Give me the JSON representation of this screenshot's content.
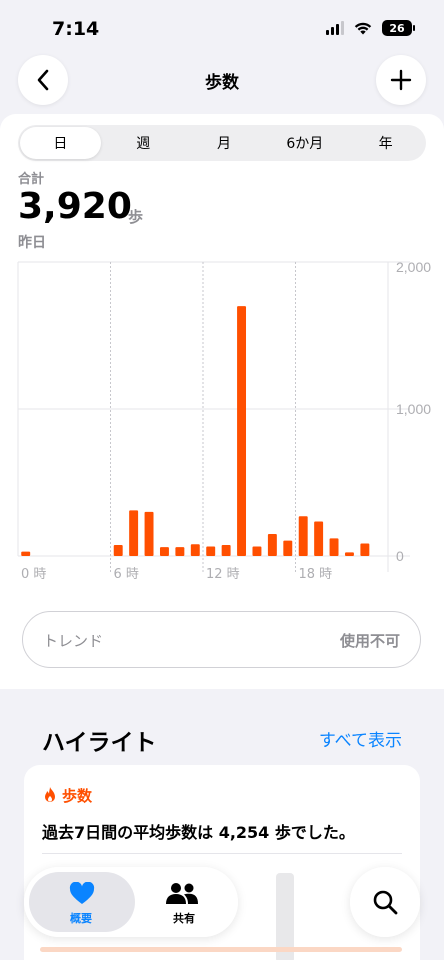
{
  "status_bar": {
    "time": "7:14",
    "battery": "26"
  },
  "nav": {
    "title": "歩数",
    "back_icon": "chevron-left-icon",
    "add_icon": "plus-icon"
  },
  "segments": [
    "日",
    "週",
    "月",
    "6か月",
    "年"
  ],
  "selected_segment": "日",
  "summary": {
    "label": "合計",
    "value": "3,920",
    "unit": "歩",
    "date": "昨日"
  },
  "chart_data": {
    "type": "bar",
    "x_tick_labels": [
      "0 時",
      "6 時",
      "12 時",
      "18 時"
    ],
    "y_tick_labels": [
      "2,000",
      "1,000",
      "0"
    ],
    "ylim": [
      0,
      2000
    ],
    "categories": [
      "0",
      "1",
      "2",
      "3",
      "4",
      "5",
      "6",
      "7",
      "8",
      "9",
      "10",
      "11",
      "12",
      "13",
      "14",
      "15",
      "16",
      "17",
      "18",
      "19",
      "20",
      "21",
      "22",
      "23"
    ],
    "values": [
      30,
      0,
      0,
      0,
      0,
      0,
      75,
      310,
      300,
      60,
      60,
      80,
      65,
      75,
      1700,
      65,
      150,
      105,
      270,
      235,
      120,
      25,
      85,
      0
    ],
    "bar_color": "#ff4f00",
    "grid": true
  },
  "trend": {
    "label": "トレンド",
    "status": "使用不可"
  },
  "highlights": {
    "title": "ハイライト",
    "show_all": "すべて表示",
    "card": {
      "category": "歩数",
      "icon": "flame-icon",
      "text": "過去7日間の平均歩数は 4,254 歩でした。"
    }
  },
  "tabs": [
    {
      "label": "概要",
      "icon": "heart-icon",
      "color": "#0a84ff",
      "selected": true
    },
    {
      "label": "共有",
      "icon": "people-icon",
      "selected": false
    }
  ],
  "search_icon": "search-icon"
}
